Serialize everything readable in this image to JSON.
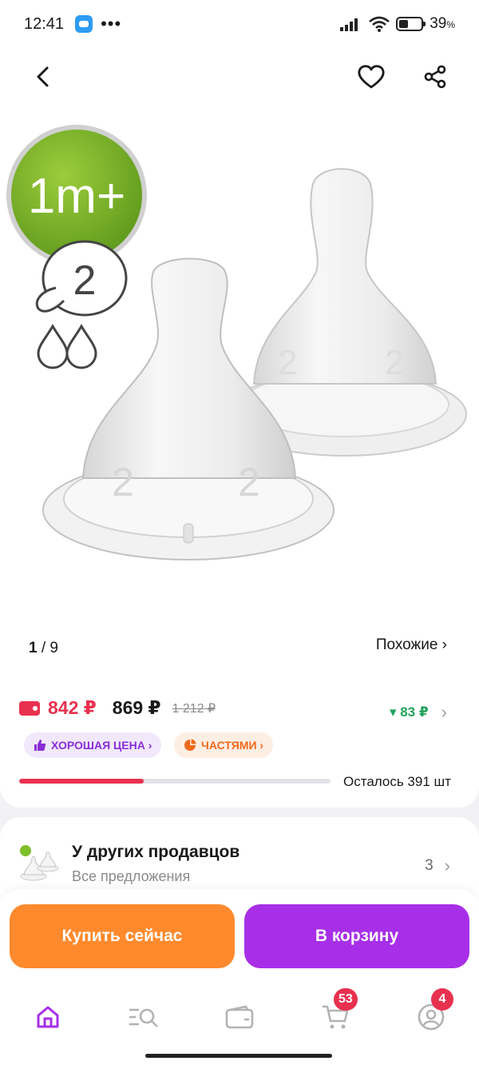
{
  "status": {
    "time": "12:41",
    "dots": "•••",
    "battery": "39",
    "battery_unit": "%"
  },
  "icons": {
    "back": "chevron-left-icon",
    "favorite": "heart-icon",
    "share": "share-icon"
  },
  "gallery": {
    "current": "1",
    "sep_total": "/ 9",
    "similar": "Похожие ›"
  },
  "product_image": {
    "badge_text": "1m+",
    "size_number": "2"
  },
  "prices": {
    "wallet_price": "842 ₽",
    "price": "869 ₽",
    "old_price": "1 212 ₽",
    "bonus": "▾ 83 ₽"
  },
  "chips": {
    "good_price": "ХОРОШАЯ ЦЕНА ›",
    "parts": "ЧАСТЯМИ ›"
  },
  "stock": {
    "fill_fraction": 0.4,
    "text": "Осталось 391 шт"
  },
  "sellers": {
    "title": "У других продавцов",
    "subtitle": "Все предложения",
    "count": "3"
  },
  "actions": {
    "buy_now": "Купить сейчас",
    "to_cart": "В корзину"
  },
  "tabs": {
    "cart_badge": "53",
    "profile_badge": "4"
  },
  "colors": {
    "accent_red": "#e8314f",
    "buy_orange": "#ff8a2d",
    "cart_purple": "#a72fe8",
    "green": "#23a35b"
  }
}
